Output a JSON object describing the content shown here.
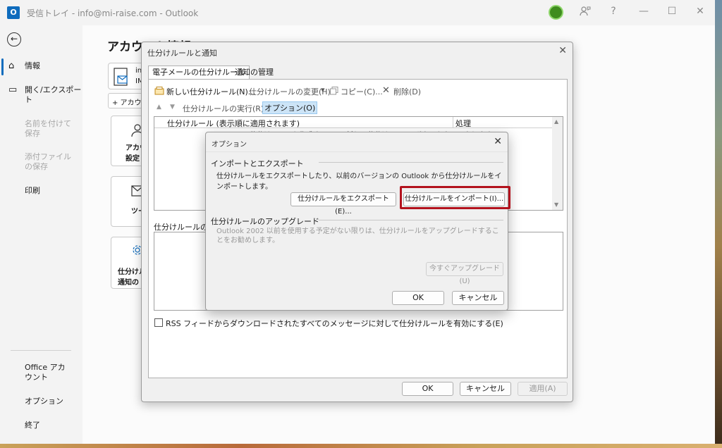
{
  "window": {
    "app_icon": "O",
    "title": "受信トレイ - info@mi-raise.com - Outlook",
    "icons": [
      "avatar",
      "feedback-icon",
      "help-icon",
      "minimize-icon",
      "maximize-icon",
      "close-icon"
    ],
    "help_label": "?",
    "minimize_label": "—",
    "maximize_label": "☐",
    "close_label": "✕"
  },
  "nav": {
    "back_label": "←",
    "items": [
      {
        "label": "情報",
        "icon": "⌂",
        "active": true,
        "disabled": false
      },
      {
        "label": "開く/エクスポート",
        "icon": "▭",
        "active": false,
        "disabled": false
      },
      {
        "label": "名前を付けて保存",
        "active": false,
        "disabled": true
      },
      {
        "label": "添付ファイルの保存",
        "active": false,
        "disabled": true
      },
      {
        "label": "印刷",
        "active": false,
        "disabled": false
      },
      {
        "label": "Office アカウント",
        "active": false,
        "disabled": false
      },
      {
        "label": "オプション",
        "active": false,
        "disabled": false
      },
      {
        "label": "終了",
        "active": false,
        "disabled": false
      }
    ]
  },
  "main": {
    "page_title": "アカウント情報",
    "account_prefix": "in",
    "account_sub": "IM",
    "add_account": "+ アカウ",
    "card_account_settings": "アカウ 設定",
    "card_tools": "ツー ",
    "card_rules": "仕分けル 通知の"
  },
  "rules_dialog": {
    "title": "仕分けルールと通知",
    "close_label": "✕",
    "tabs": [
      "電子メールの仕分けルール",
      "通知の管理"
    ],
    "toolbar": {
      "new_rule": "新しい仕分けルール(N)...",
      "change_rule": "仕分けルールの変更(H)",
      "copy": "コピー(C)...",
      "delete": "削除(D)",
      "run_rules": "仕分けルールの実行(R)...",
      "options": "オプション(O)",
      "up_arrow": "▲",
      "down_arrow": "▼",
      "dropdown_arrow": "▾",
      "delete_glyph": "✕"
    },
    "list": {
      "col_rule": "仕分けルール (表示順に適用されます)",
      "col_action": "処理",
      "hint": "仕分けルールを作成するには [新しい仕分けルール] ボタンをクリックします。",
      "scroll_up": "▲",
      "scroll_down": "▼"
    },
    "description_label": "仕分けルールの説明",
    "rss_label": "RSS フィードからダウンロードされたすべてのメッセージに対して仕分けルールを有効にする(E)",
    "buttons": {
      "ok": "OK",
      "cancel": "キャンセル",
      "apply": "適用(A)"
    }
  },
  "options_dialog": {
    "title": "オプション",
    "close_label": "✕",
    "import_export_group": "インポートとエクスポート",
    "import_export_desc": "仕分けルールをエクスポートしたり、以前のバージョンの Outlook から仕分けルールをインポートします。",
    "export_button": "仕分けルールをエクスポート(E)...",
    "import_button": "仕分けルールをインポート(I)...",
    "upgrade_group": "仕分けルールのアップグレード",
    "upgrade_desc": "Outlook 2002 以前を使用する予定がない限りは、仕分けルールをアップグレードすることをお勧めします。",
    "upgrade_button": "今すぐアップグレード(U)",
    "ok": "OK",
    "cancel": "キャンセル"
  },
  "colors": {
    "accent": "#0f6cbd",
    "highlight": "#b3121d",
    "options_selected": "#cce4f7"
  }
}
